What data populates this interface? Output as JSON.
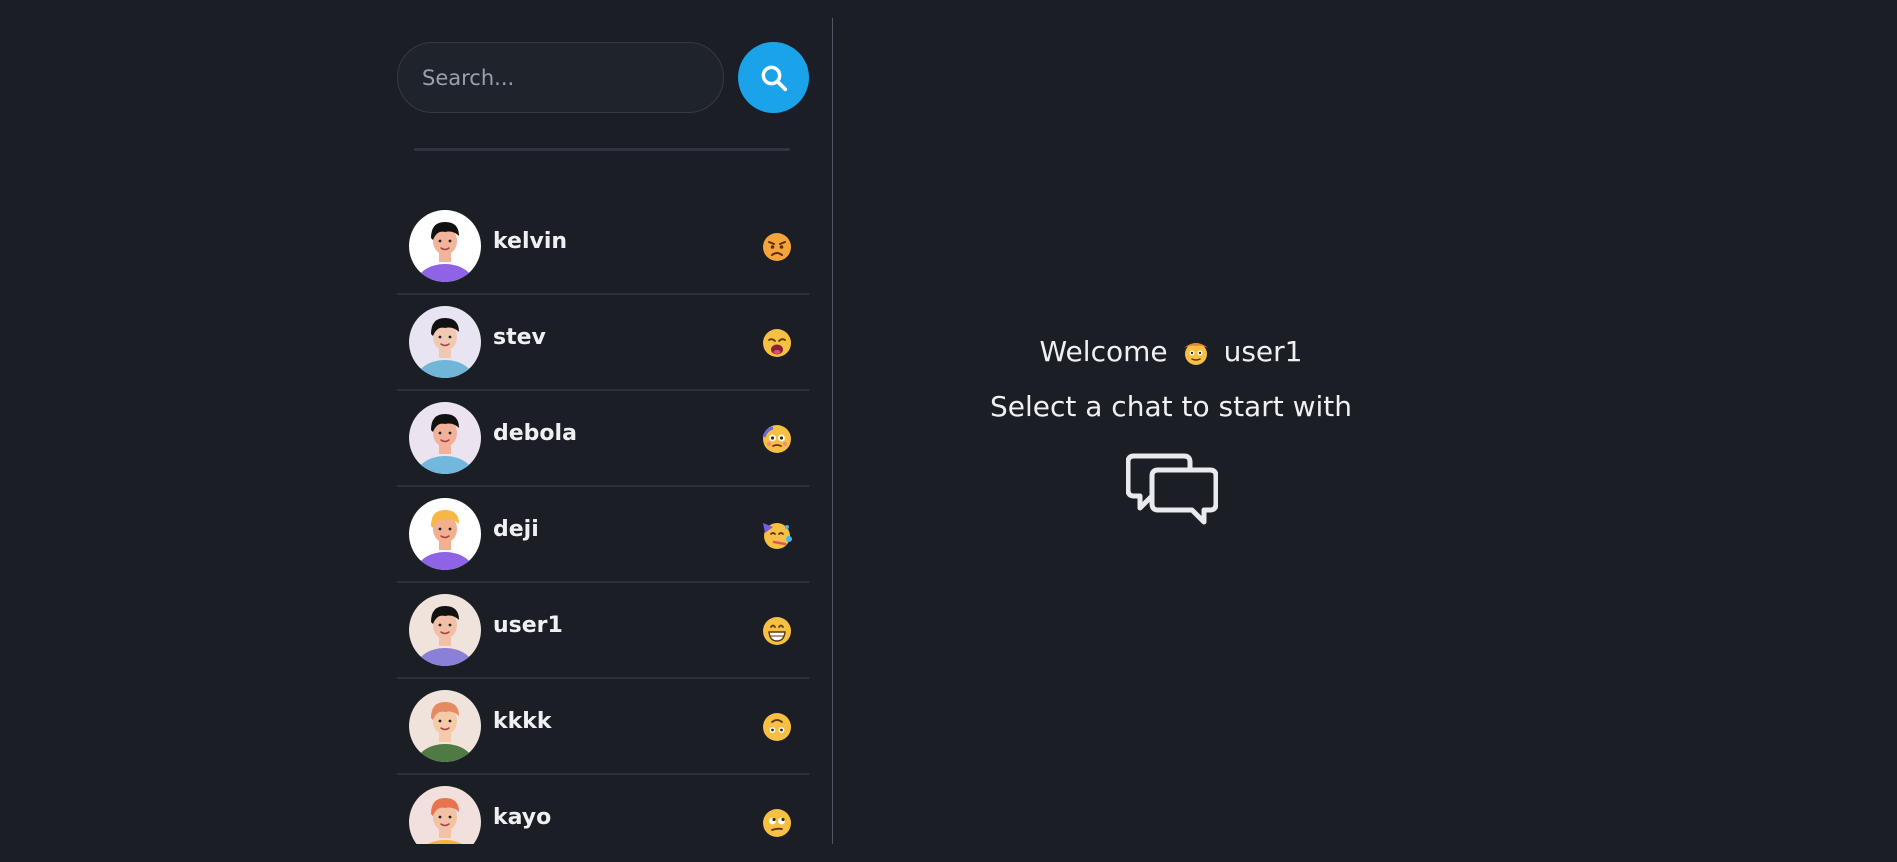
{
  "search": {
    "placeholder": "Search..."
  },
  "chats": [
    {
      "name": "kelvin",
      "avatar_bg": "#ffffff",
      "shirt": "#8e63e6",
      "hair": "#111111",
      "skin": "#f3b59a",
      "mood_icon": "angry-face-icon"
    },
    {
      "name": "stev",
      "avatar_bg": "#e9e4f2",
      "shirt": "#6fb6d9",
      "hair": "#111111",
      "skin": "#f1c9b3",
      "mood_icon": "weary-face-icon"
    },
    {
      "name": "debola",
      "avatar_bg": "#ebe3f0",
      "shirt": "#72b7dc",
      "hair": "#111111",
      "skin": "#f3b199",
      "mood_icon": "woozy-face-icon"
    },
    {
      "name": "deji",
      "avatar_bg": "#ffffff",
      "shirt": "#8e63e6",
      "hair": "#f7b744",
      "skin": "#f3b08f",
      "mood_icon": "partying-face-icon"
    },
    {
      "name": "user1",
      "avatar_bg": "#efe3dc",
      "shirt": "#8a80d8",
      "hair": "#111111",
      "skin": "#f1c0a7",
      "mood_icon": "grinning-face-icon"
    },
    {
      "name": "kkkk",
      "avatar_bg": "#efe3dc",
      "shirt": "#4f7a43",
      "hair": "#e58a62",
      "skin": "#f6caa8",
      "mood_icon": "upside-down-face-icon"
    },
    {
      "name": "kayo",
      "avatar_bg": "#f1e0dc",
      "shirt": "#f7b23e",
      "hair": "#e7744f",
      "skin": "#f3c1a4",
      "mood_icon": "rolling-eyes-face-icon"
    }
  ],
  "main": {
    "welcome": "Welcome",
    "welcome_emoji": "cowboy-face-icon",
    "username": "user1",
    "subtitle": "Select a chat to start with"
  },
  "colors": {
    "background": "#1b1e25",
    "accent": "#1aa3e8",
    "text": "#eef0f3"
  }
}
